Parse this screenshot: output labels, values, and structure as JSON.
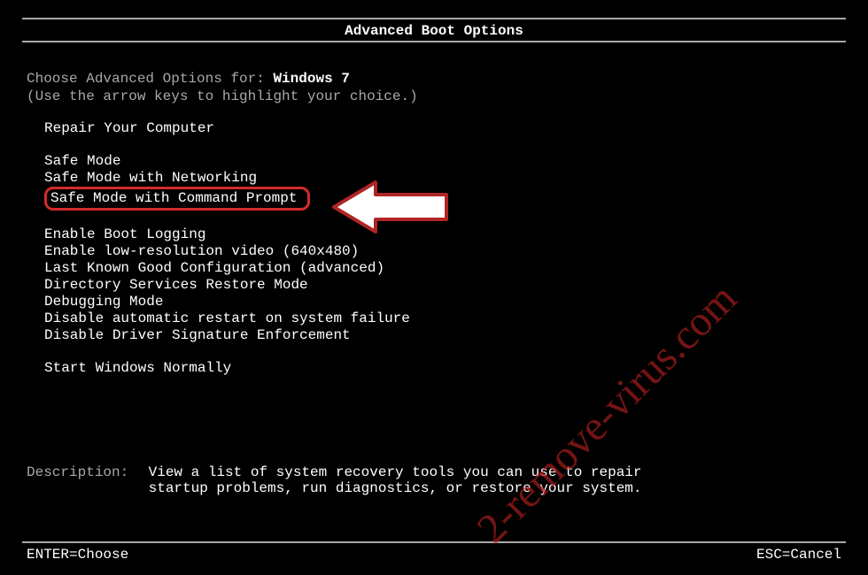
{
  "title": "Advanced Boot Options",
  "prompt": {
    "prefix": "Choose Advanced Options for: ",
    "os": "Windows 7",
    "hint": "(Use the arrow keys to highlight your choice.)"
  },
  "menu": {
    "group1": [
      "Repair Your Computer"
    ],
    "group2": [
      "Safe Mode",
      "Safe Mode with Networking",
      "Safe Mode with Command Prompt"
    ],
    "group3": [
      "Enable Boot Logging",
      "Enable low-resolution video (640x480)",
      "Last Known Good Configuration (advanced)",
      "Directory Services Restore Mode",
      "Debugging Mode",
      "Disable automatic restart on system failure",
      "Disable Driver Signature Enforcement"
    ],
    "group4": [
      "Start Windows Normally"
    ]
  },
  "description": {
    "label": "Description:",
    "text": "View a list of system recovery tools you can use to repair startup problems, run diagnostics, or restore your system."
  },
  "footer": {
    "enter": "ENTER=Choose",
    "esc": "ESC=Cancel"
  },
  "watermark": "2-remove-virus.com",
  "highlighted_index": 2
}
